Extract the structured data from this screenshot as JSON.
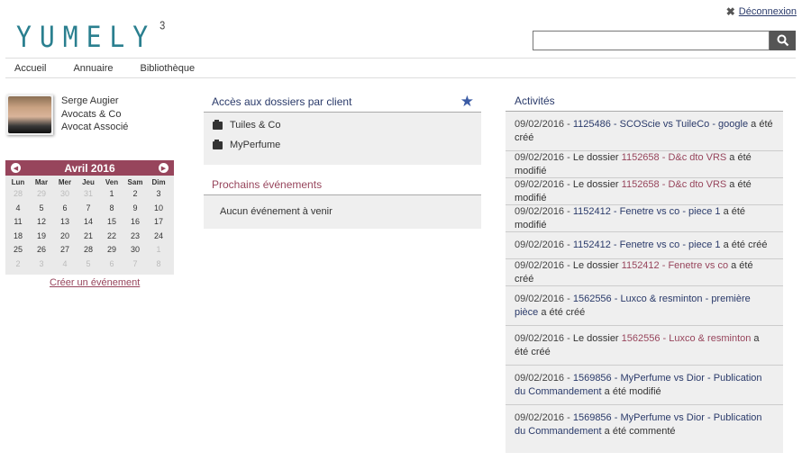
{
  "header": {
    "logo": "YUMELY",
    "logo_sup": "3",
    "logout_label": "Déconnexion",
    "search": {
      "value": "",
      "placeholder": ""
    }
  },
  "nav": {
    "items": [
      "Accueil",
      "Annuaire",
      "Bibliothèque"
    ]
  },
  "profile": {
    "name": "Serge Augier",
    "company": "Avocats & Co",
    "role": "Avocat Associé"
  },
  "calendar": {
    "month_label": "Avril 2016",
    "weekdays": [
      "Lun",
      "Mar",
      "Mer",
      "Jeu",
      "Ven",
      "Sam",
      "Dim"
    ],
    "weeks": [
      [
        "28",
        "29",
        "30",
        "31",
        "1",
        "2",
        "3"
      ],
      [
        "4",
        "5",
        "6",
        "7",
        "8",
        "9",
        "10"
      ],
      [
        "11",
        "12",
        "13",
        "14",
        "15",
        "16",
        "17"
      ],
      [
        "18",
        "19",
        "20",
        "21",
        "22",
        "23",
        "24"
      ],
      [
        "25",
        "26",
        "27",
        "28",
        "29",
        "30",
        "1"
      ],
      [
        "2",
        "3",
        "4",
        "5",
        "6",
        "7",
        "8"
      ]
    ],
    "create_label": "Créer un événement"
  },
  "folders": {
    "title": "Accès aux dossiers par client",
    "items": [
      "Tuiles & Co",
      "MyPerfume"
    ]
  },
  "events": {
    "title": "Prochains événements",
    "empty": "Aucun événement à venir"
  },
  "activities": {
    "title": "Activités",
    "items": [
      {
        "date": "09/02/2016",
        "parts": [
          [
            "n",
            "1125486 - SCOScie vs TuileCo - google"
          ],
          [
            "t",
            " a été créé"
          ]
        ]
      },
      {
        "date": "09/02/2016",
        "parts": [
          [
            "t",
            "Le dossier "
          ],
          [
            "p",
            "1152658 - D&c dto VRS"
          ],
          [
            "t",
            " a été modifié"
          ]
        ]
      },
      {
        "date": "09/02/2016",
        "parts": [
          [
            "t",
            "Le dossier "
          ],
          [
            "p",
            "1152658 - D&c dto VRS"
          ],
          [
            "t",
            " a été modifié"
          ]
        ]
      },
      {
        "date": "09/02/2016",
        "parts": [
          [
            "n",
            "1152412 - Fenetre vs co - piece 1"
          ],
          [
            "t",
            " a été modifié"
          ]
        ]
      },
      {
        "date": "09/02/2016",
        "parts": [
          [
            "n",
            "1152412 - Fenetre vs co - piece 1"
          ],
          [
            "t",
            " a été créé"
          ]
        ]
      },
      {
        "date": "09/02/2016",
        "parts": [
          [
            "t",
            "Le dossier "
          ],
          [
            "p",
            "1152412 - Fenetre vs co"
          ],
          [
            "t",
            " a été créé"
          ]
        ]
      },
      {
        "date": "09/02/2016",
        "parts": [
          [
            "n",
            "1562556 - Luxco & resminton - première pièce"
          ],
          [
            "t",
            " a été créé"
          ]
        ]
      },
      {
        "date": "09/02/2016",
        "parts": [
          [
            "t",
            "Le dossier "
          ],
          [
            "p",
            "1562556 - Luxco & resminton"
          ],
          [
            "t",
            " a été créé"
          ]
        ]
      },
      {
        "date": "09/02/2016",
        "parts": [
          [
            "n",
            "1569856 - MyPerfume vs Dior - Publication du Commandement"
          ],
          [
            "t",
            " a été modifié"
          ]
        ]
      },
      {
        "date": "09/02/2016",
        "parts": [
          [
            "n",
            "1569856 - MyPerfume vs Dior - Publication du Commandement"
          ],
          [
            "t",
            " a été commenté"
          ]
        ]
      }
    ]
  }
}
